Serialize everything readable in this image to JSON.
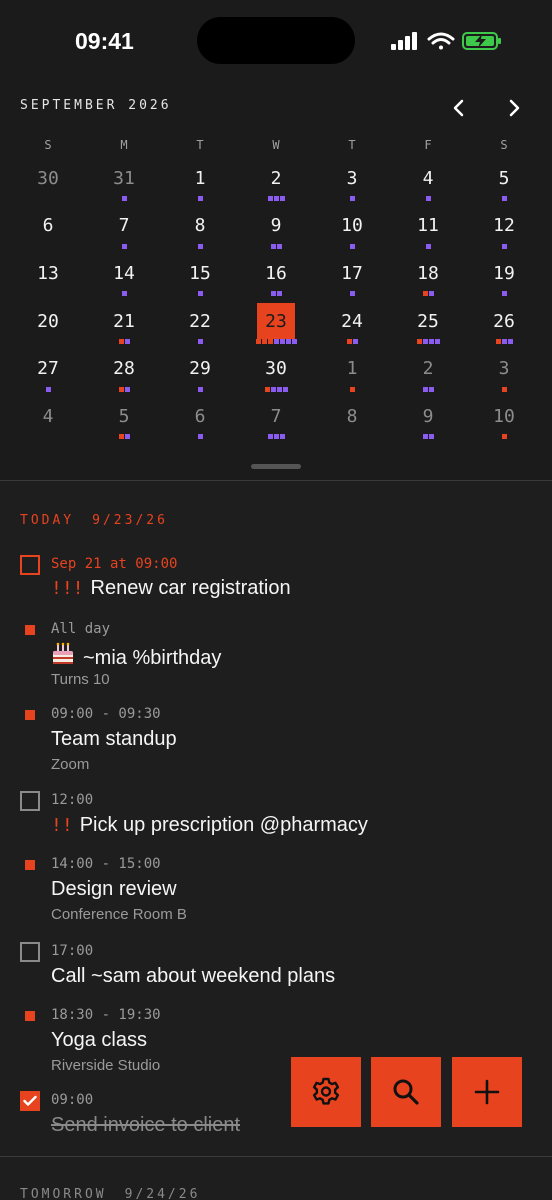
{
  "status": {
    "time": "09:41"
  },
  "calendar": {
    "month_title": "SEPTEMBER 2026",
    "weekdays": [
      "S",
      "M",
      "T",
      "W",
      "T",
      "F",
      "S"
    ],
    "days": [
      {
        "n": "30",
        "other": true,
        "dots": ""
      },
      {
        "n": "31",
        "other": true,
        "dots": "p"
      },
      {
        "n": "1",
        "dots": "p"
      },
      {
        "n": "2",
        "dots": "ppp"
      },
      {
        "n": "3",
        "dots": "p"
      },
      {
        "n": "4",
        "dots": "p"
      },
      {
        "n": "5",
        "dots": "p"
      },
      {
        "n": "6",
        "dots": ""
      },
      {
        "n": "7",
        "dots": "p"
      },
      {
        "n": "8",
        "dots": "p"
      },
      {
        "n": "9",
        "dots": "pp"
      },
      {
        "n": "10",
        "dots": "p"
      },
      {
        "n": "11",
        "dots": "p"
      },
      {
        "n": "12",
        "dots": "p"
      },
      {
        "n": "13",
        "dots": ""
      },
      {
        "n": "14",
        "dots": "p"
      },
      {
        "n": "15",
        "dots": "p"
      },
      {
        "n": "16",
        "dots": "pp"
      },
      {
        "n": "17",
        "dots": "p"
      },
      {
        "n": "18",
        "dots": "op"
      },
      {
        "n": "19",
        "dots": "p"
      },
      {
        "n": "20",
        "dots": ""
      },
      {
        "n": "21",
        "dots": "op"
      },
      {
        "n": "22",
        "dots": "p"
      },
      {
        "n": "23",
        "today": true,
        "dots": "ooopppp"
      },
      {
        "n": "24",
        "dots": "op"
      },
      {
        "n": "25",
        "dots": "oppp"
      },
      {
        "n": "26",
        "dots": "opp"
      },
      {
        "n": "27",
        "dots": "p"
      },
      {
        "n": "28",
        "dots": "op"
      },
      {
        "n": "29",
        "dots": "p"
      },
      {
        "n": "30",
        "dots": "oppp"
      },
      {
        "n": "1",
        "other": true,
        "dots": "o"
      },
      {
        "n": "2",
        "other": true,
        "dots": "pp"
      },
      {
        "n": "3",
        "other": true,
        "dots": "o"
      },
      {
        "n": "4",
        "other": true,
        "dots": ""
      },
      {
        "n": "5",
        "other": true,
        "dots": "op"
      },
      {
        "n": "6",
        "other": true,
        "dots": "p"
      },
      {
        "n": "7",
        "other": true,
        "dots": "ppp"
      },
      {
        "n": "8",
        "other": true,
        "dots": ""
      },
      {
        "n": "9",
        "other": true,
        "dots": "pp"
      },
      {
        "n": "10",
        "other": true,
        "dots": "o"
      }
    ]
  },
  "agenda": {
    "today_label": "TODAY",
    "today_date": "9/23/26",
    "items": [
      {
        "meta": "Sep 21 at 09:00",
        "bang": "!!!",
        "title": "Renew car registration"
      },
      {
        "meta": "All day",
        "title": "~mia %birthday",
        "sub": "Turns 10"
      },
      {
        "meta": "09:00 - 09:30",
        "title": "Team standup",
        "sub": "Zoom"
      },
      {
        "meta": "12:00",
        "bang": "!!",
        "title": "Pick up prescription @pharmacy"
      },
      {
        "meta": "14:00 - 15:00",
        "title": "Design review",
        "sub": "Conference Room B"
      },
      {
        "meta": "17:00",
        "title": "Call ~sam about weekend plans"
      },
      {
        "meta": "18:30 - 19:30",
        "title": "Yoga class",
        "sub": "Riverside Studio"
      },
      {
        "meta": "09:00",
        "title": "Send invoice to client"
      }
    ],
    "tomorrow_label": "TOMORROW",
    "tomorrow_date": "9/24/26"
  },
  "colors": {
    "accent": "#e8431f",
    "dot_purple": "#8a5cf0",
    "background": "#1e1e1e"
  },
  "icons": {
    "settings": "gear-icon",
    "search": "search-icon",
    "add": "plus-icon"
  }
}
